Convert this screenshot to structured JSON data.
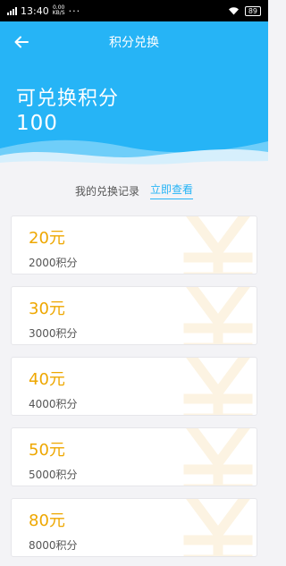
{
  "status_bar": {
    "time": "13:40",
    "net_speed_value": "0.00",
    "net_speed_unit": "KB/S",
    "dots": "···",
    "battery": "89"
  },
  "nav": {
    "back_icon": "arrow-left-icon",
    "title": "积分兑换"
  },
  "points": {
    "label": "可兑换积分",
    "value": "100"
  },
  "records": {
    "label": "我的兑换记录",
    "link": "立即查看"
  },
  "colors": {
    "accent": "#26b4f6",
    "amount": "#eea700",
    "watermark": "#fcf3e2"
  },
  "exchange_items": [
    {
      "amount": "20元",
      "points": "2000积分"
    },
    {
      "amount": "30元",
      "points": "3000积分"
    },
    {
      "amount": "40元",
      "points": "4000积分"
    },
    {
      "amount": "50元",
      "points": "5000积分"
    },
    {
      "amount": "80元",
      "points": "8000积分"
    }
  ]
}
